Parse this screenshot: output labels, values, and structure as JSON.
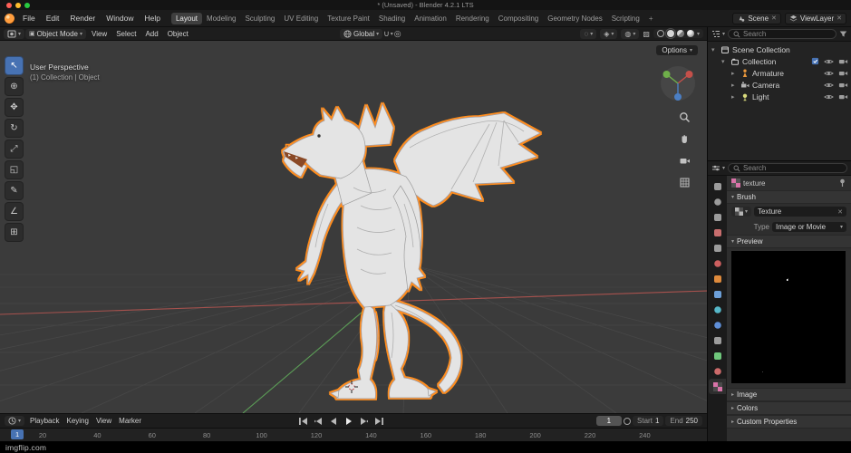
{
  "window": {
    "title": "* (Unsaved) - Blender 4.2.1 LTS"
  },
  "topbar": {
    "menus": [
      "File",
      "Edit",
      "Render",
      "Window",
      "Help"
    ],
    "workspaces": [
      "Layout",
      "Modeling",
      "Sculpting",
      "UV Editing",
      "Texture Paint",
      "Shading",
      "Animation",
      "Rendering",
      "Compositing",
      "Geometry Nodes",
      "Scripting"
    ],
    "active_workspace": "Layout",
    "add_workspace": "+",
    "scene": "Scene",
    "viewlayer": "ViewLayer"
  },
  "viewport_header": {
    "mode": "Object Mode",
    "menus": [
      "View",
      "Select",
      "Add",
      "Object"
    ],
    "orientation": "Global"
  },
  "viewport": {
    "overlay_top": "User Perspective",
    "overlay_sub": "(1) Collection | Object",
    "options": "Options",
    "tools": [
      {
        "name": "select-box-tool",
        "glyph": "↖",
        "active": true
      },
      {
        "name": "cursor-tool",
        "glyph": "⊕"
      },
      {
        "name": "move-tool",
        "glyph": "✥"
      },
      {
        "name": "rotate-tool",
        "glyph": "↻"
      },
      {
        "name": "scale-tool",
        "glyph": "⤢"
      },
      {
        "name": "transform-tool",
        "glyph": "◱"
      },
      {
        "name": "annotate-tool",
        "glyph": "✎"
      },
      {
        "name": "measure-tool",
        "glyph": "∠"
      },
      {
        "name": "add-cube-tool",
        "glyph": "⊞"
      }
    ]
  },
  "outliner": {
    "search_placeholder": "Search",
    "rows": [
      {
        "label": "Scene Collection",
        "depth": 0,
        "icon": "scene-collection",
        "caret": "▾",
        "check": false,
        "eye": false,
        "cam": false
      },
      {
        "label": "Collection",
        "depth": 1,
        "icon": "collection",
        "caret": "▾",
        "check": true,
        "eye": true,
        "cam": true
      },
      {
        "label": "Armature",
        "depth": 2,
        "icon": "armature",
        "caret": "▸",
        "check": false,
        "eye": true,
        "cam": true
      },
      {
        "label": "Camera",
        "depth": 2,
        "icon": "camera",
        "caret": "▸",
        "check": false,
        "eye": true,
        "cam": true
      },
      {
        "label": "Light",
        "depth": 2,
        "icon": "light",
        "caret": "▸",
        "check": false,
        "eye": true,
        "cam": true
      }
    ]
  },
  "properties": {
    "search_placeholder": "Search",
    "context_name": "texture",
    "texture_datablock": "Texture",
    "type_label": "Type",
    "type_value": "Image or Movie",
    "sections": {
      "brush": "Brush",
      "preview": "Preview",
      "image": "Image",
      "colors": "Colors",
      "custom": "Custom Properties"
    },
    "tabs": [
      {
        "name": "tool-tab",
        "color": "#9c9c9c",
        "shape": "square"
      },
      {
        "name": "render-tab",
        "color": "#9c9c9c",
        "shape": "circle"
      },
      {
        "name": "output-tab",
        "color": "#9c9c9c",
        "shape": "square"
      },
      {
        "name": "view-layer-tab",
        "color": "#c86e6e",
        "shape": "square"
      },
      {
        "name": "scene-tab",
        "color": "#9c9c9c",
        "shape": "square"
      },
      {
        "name": "world-tab",
        "color": "#cc5f5f",
        "shape": "circle"
      },
      {
        "name": "object-tab",
        "color": "#de8a3c",
        "shape": "square"
      },
      {
        "name": "modifiers-tab",
        "color": "#6c9fd8",
        "shape": "square"
      },
      {
        "name": "particles-tab",
        "color": "#56b8c9",
        "shape": "circle"
      },
      {
        "name": "physics-tab",
        "color": "#5f8fd8",
        "shape": "circle"
      },
      {
        "name": "constraints-tab",
        "color": "#9c9c9c",
        "shape": "square"
      },
      {
        "name": "object-data-tab",
        "color": "#6fc77c",
        "shape": "square"
      },
      {
        "name": "material-tab",
        "color": "#cc6a6a",
        "shape": "circle"
      },
      {
        "name": "texture-tab",
        "color": "#d873a8",
        "shape": "checker",
        "selected": true
      }
    ]
  },
  "timeline": {
    "menus": [
      "Playback",
      "Keying",
      "View",
      "Marker"
    ],
    "transport": [
      "jump-to-start",
      "prev-keyframe",
      "play-reverse",
      "play",
      "next-keyframe",
      "jump-to-end"
    ],
    "current_frame": "1",
    "start_label": "Start",
    "start_value": "1",
    "end_label": "End",
    "end_value": "250",
    "frames": [
      20,
      40,
      60,
      80,
      100,
      120,
      140,
      160,
      180,
      200,
      220,
      240
    ],
    "playhead_frame": "1"
  },
  "watermark": {
    "text": "imgflip.com"
  },
  "colors": {
    "accent": "#4772b3",
    "selection_outline": "#ff8d1c"
  }
}
